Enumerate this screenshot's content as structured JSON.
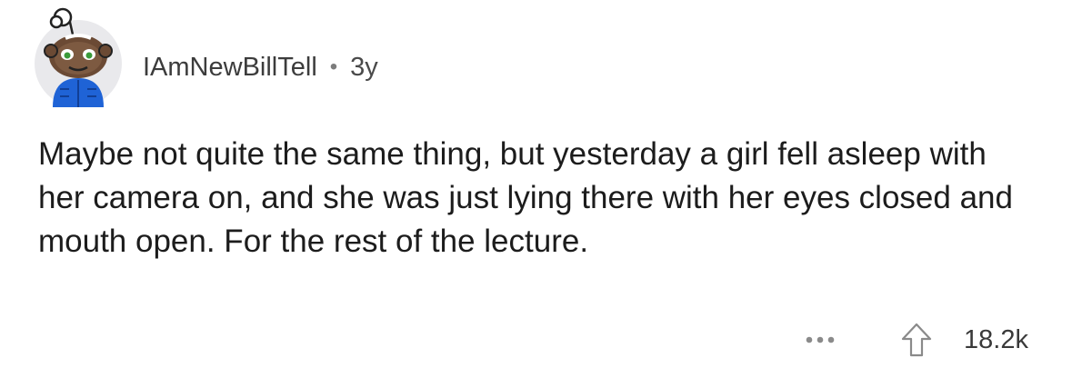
{
  "comment": {
    "username": "IAmNewBillTell",
    "separator": "•",
    "age": "3y",
    "body": "Maybe not quite the same thing, but yesterday a girl fell asleep with her camera on, and she was just lying there with her eyes closed and mouth open. For the rest of the lecture.",
    "score": "18.2k"
  },
  "icons": {
    "avatar": "snoo-avatar-icon",
    "more": "more-options-icon",
    "upvote": "upvote-arrow-icon"
  },
  "colors": {
    "avatar_bg": "#e9e9ec",
    "jacket": "#1f63d6",
    "icon_gray": "#8a8a8a"
  }
}
